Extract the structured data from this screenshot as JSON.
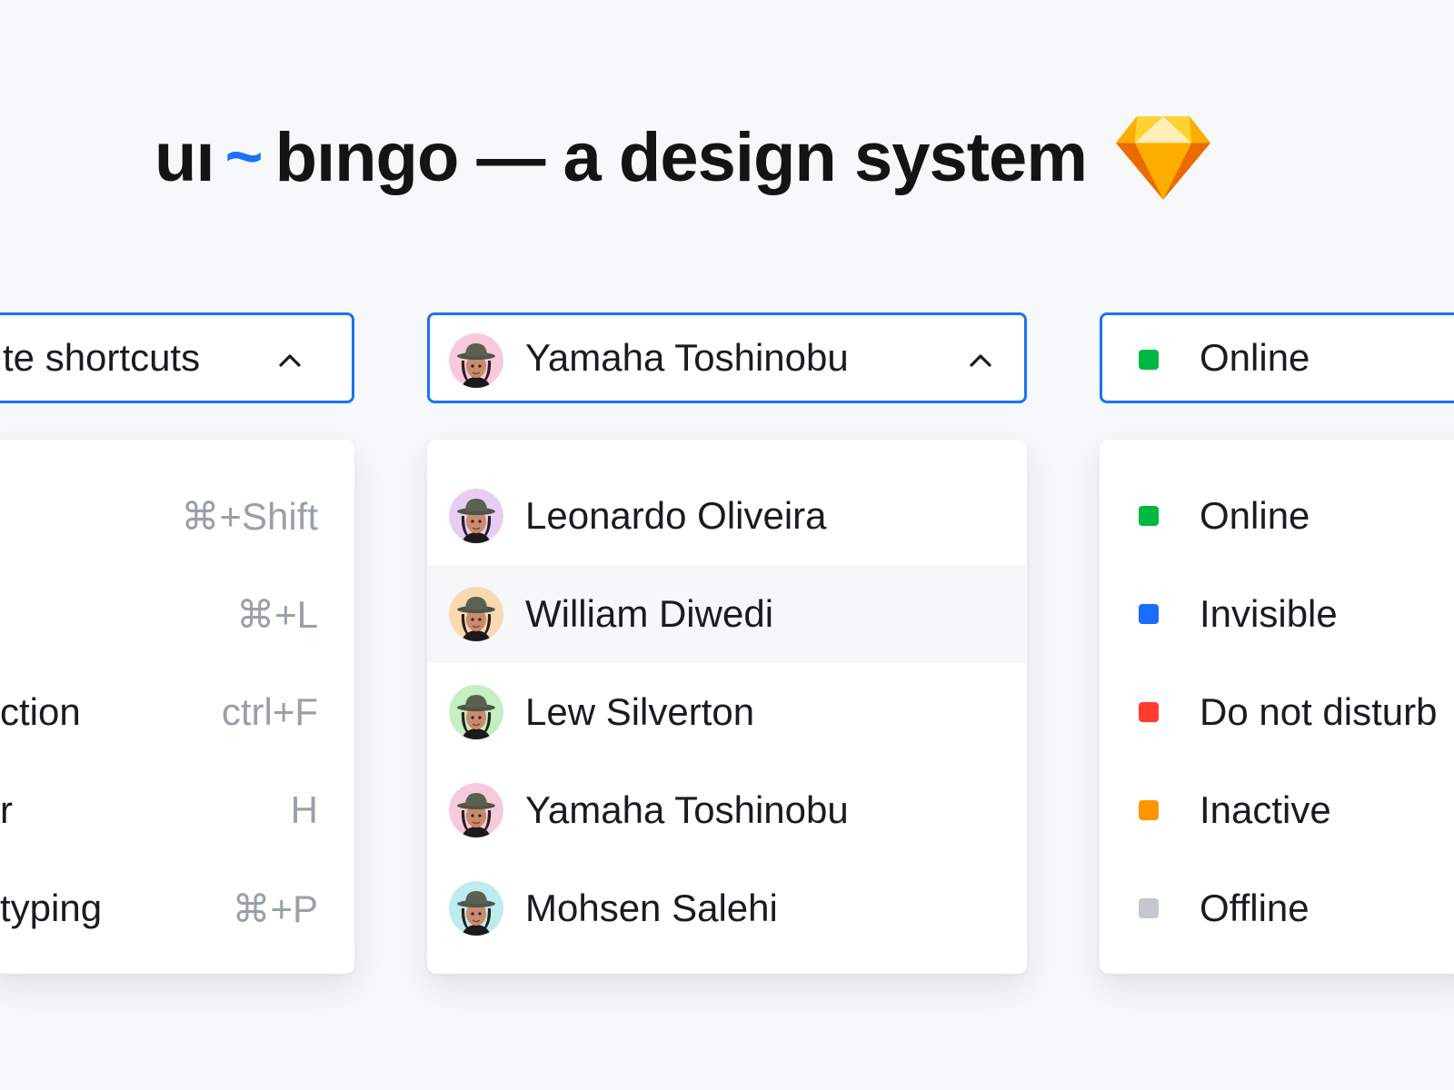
{
  "header": {
    "brand_left": "uı",
    "brand_tilde": "~",
    "brand_right": "bıngo",
    "subtitle": "— a design system"
  },
  "shortcuts": {
    "selected_label": "te shortcuts",
    "items": [
      {
        "label": "",
        "key": "⌘+Shift"
      },
      {
        "label": "",
        "key": "⌘+L"
      },
      {
        "label": "ction",
        "key": "ctrl+F"
      },
      {
        "label": "r",
        "key": "H"
      },
      {
        "label": "typing",
        "key": "⌘+P"
      }
    ]
  },
  "users": {
    "selected_name": "Yamaha Toshinobu",
    "items": [
      {
        "name": "Leonardo Oliveira",
        "avatar_bg": "#e8cdf3"
      },
      {
        "name": "William Diwedi",
        "avatar_bg": "#f8d9b0"
      },
      {
        "name": "Lew Silverton",
        "avatar_bg": "#c3efc2"
      },
      {
        "name": "Yamaha Toshinobu",
        "avatar_bg": "#f7c9dc"
      },
      {
        "name": "Mohsen Salehi",
        "avatar_bg": "#bdebf0"
      }
    ],
    "selected_avatar_bg": "#f7c9dc",
    "highlighted_index": 1
  },
  "status": {
    "selected_label": "Online",
    "selected_color": "#00b83f",
    "items": [
      {
        "label": "Online",
        "color": "#00b83f"
      },
      {
        "label": "Invisible",
        "color": "#1a6bff"
      },
      {
        "label": "Do not disturb",
        "color": "#ff3b30"
      },
      {
        "label": "Inactive",
        "color": "#ff9500"
      },
      {
        "label": "Offline",
        "color": "#c3c7cf"
      }
    ]
  },
  "colors": {
    "accent": "#1a73f5",
    "text": "#1a1b1f",
    "muted": "#9aa0aa",
    "background": "#f7f8fa"
  },
  "icons": [
    "sketch-diamond-icon",
    "chevron-up-icon",
    "memoji-avatar-icon"
  ]
}
